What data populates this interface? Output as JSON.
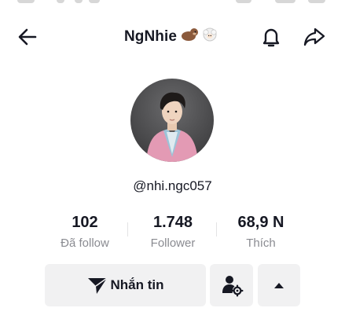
{
  "header": {
    "title": "NgNhie",
    "title_emoji": "🦦🐑",
    "icons": {
      "back": "arrow-left-icon",
      "notifications": "bell-icon",
      "share": "share-arrow-icon"
    }
  },
  "profile": {
    "username": "@nhi.ngc057"
  },
  "stats": [
    {
      "value": "102",
      "label": "Đã follow"
    },
    {
      "value": "1.748",
      "label": "Follower"
    },
    {
      "value": "68,9 N",
      "label": "Thích"
    }
  ],
  "actions": {
    "message_label": "Nhắn tin",
    "message_icon": "send-icon",
    "follow_settings_icon": "user-gear-icon",
    "more_icon": "caret-up-icon"
  },
  "colors": {
    "text_primary": "#161823",
    "text_secondary": "#8a8b91",
    "button_bg": "#f1f1f2"
  }
}
